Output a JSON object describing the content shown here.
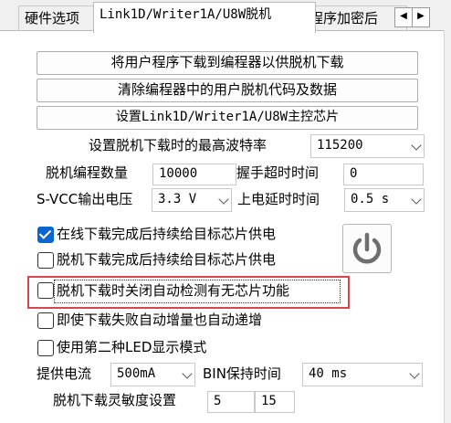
{
  "tabs": [
    {
      "label": "硬件选项"
    },
    {
      "label": "Link1D/Writer1A/U8W脱机"
    },
    {
      "label": "程序加密后"
    }
  ],
  "buttons": {
    "download": "将用户程序下载到编程器以供脱机下载",
    "clear": "清除编程器中的用户脱机代码及数据",
    "set_chip": "设置Link1D/Writer1A/U8W主控芯片"
  },
  "baud": {
    "label": "设置脱机下载时的最高波特率",
    "value": "115200"
  },
  "offline_count": {
    "label": "脱机编程数量",
    "value": "10000"
  },
  "handshake_timeout": {
    "label": "握手超时时间",
    "value": "0"
  },
  "svcc": {
    "label": "S-VCC输出电压",
    "value": "3.3 V"
  },
  "power_delay": {
    "label": "上电延时时间",
    "value": "0.5 s"
  },
  "checks": [
    {
      "label": "在线下载完成后持续给目标芯片供电",
      "checked": true
    },
    {
      "label": "脱机下载完成后持续给目标芯片供电",
      "checked": false
    },
    {
      "label": "脱机下载时关闭自动检测有无芯片功能",
      "checked": false
    },
    {
      "label": "即使下载失败自动增量也自动递增",
      "checked": false
    },
    {
      "label": "使用第二种LED显示模式",
      "checked": false
    }
  ],
  "current": {
    "label": "提供电流",
    "value": "500mA"
  },
  "bin_hold": {
    "label": "BIN保持时间",
    "value": "40 ms"
  },
  "sensitivity": {
    "label": "脱机下载灵敏度设置",
    "value1": "5",
    "value2": "15"
  },
  "colors": {
    "accent": "#0a66cf",
    "highlight": "#d9454e"
  }
}
